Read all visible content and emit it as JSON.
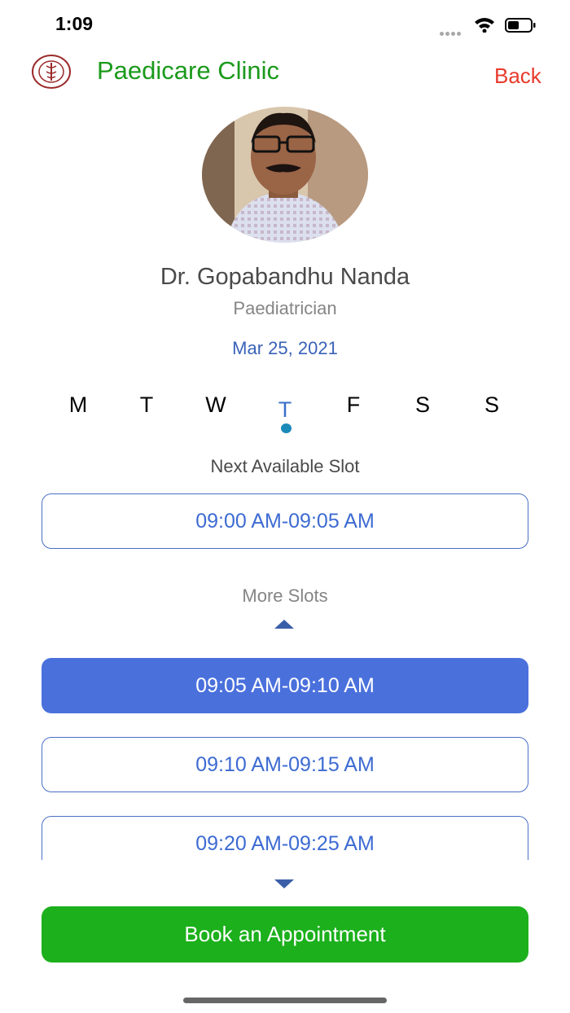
{
  "status_bar": {
    "time": "1:09"
  },
  "header": {
    "clinic_name": "Paedicare Clinic",
    "back_label": "Back",
    "logo_text": "PAEDICARE CLINIC"
  },
  "doctor": {
    "name": "Dr. Gopabandhu Nanda",
    "specialty": "Paediatrician"
  },
  "selected_date": "Mar 25, 2021",
  "week_days": [
    "M",
    "T",
    "W",
    "T",
    "F",
    "S",
    "S"
  ],
  "next_available": {
    "label": "Next Available Slot",
    "slot": "09:00 AM-09:05 AM"
  },
  "more_slots": {
    "label": "More Slots",
    "slots": [
      "09:05 AM-09:10 AM",
      "09:10 AM-09:15 AM",
      "09:20 AM-09:25 AM"
    ]
  },
  "book_button": "Book an Appointment",
  "colors": {
    "accent_green": "#1cb01c",
    "slot_blue": "#4a70dc",
    "back_red": "#e83a2c"
  }
}
